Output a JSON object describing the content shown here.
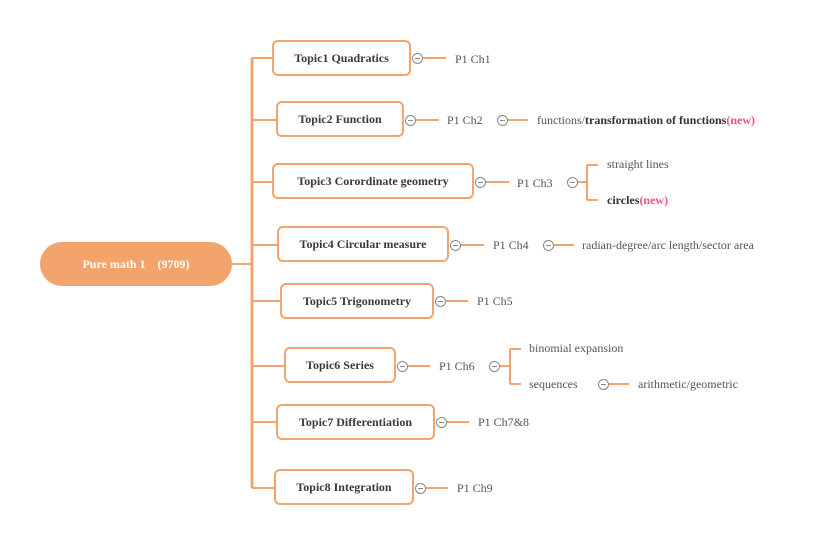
{
  "root": {
    "label": "Pure math 1    (9709)"
  },
  "colors": {
    "accent": "#f3a46c",
    "new_tag": "#f0527a",
    "text": "#444444"
  },
  "topics": [
    {
      "label": "Topic1 Quadratics",
      "chapter": "P1 Ch1"
    },
    {
      "label": "Topic2 Function",
      "chapter": "P1 Ch2",
      "sub": [
        {
          "plain": "functions/",
          "bold": "transformation of functions",
          "new": "(new)"
        }
      ]
    },
    {
      "label": "Topic3 Corordinate geometry",
      "chapter": "P1 Ch3",
      "sub": [
        {
          "plain": "straight lines"
        },
        {
          "bold": "circles",
          "new": "(new)"
        }
      ]
    },
    {
      "label": "Topic4 Circular measure",
      "chapter": "P1 Ch4",
      "sub": [
        {
          "plain": "radian-degree/arc length/sector area"
        }
      ]
    },
    {
      "label": "Topic5 Trigonometry",
      "chapter": "P1 Ch5"
    },
    {
      "label": "Topic6 Series",
      "chapter": "P1 Ch6",
      "sub": [
        {
          "plain": "binomial expansion"
        },
        {
          "plain": "sequences",
          "child": "arithmetic/geometric"
        }
      ]
    },
    {
      "label": "Topic7 Differentiation",
      "chapter": "P1 Ch7&8"
    },
    {
      "label": "Topic8 Integration",
      "chapter": "P1 Ch9"
    }
  ]
}
